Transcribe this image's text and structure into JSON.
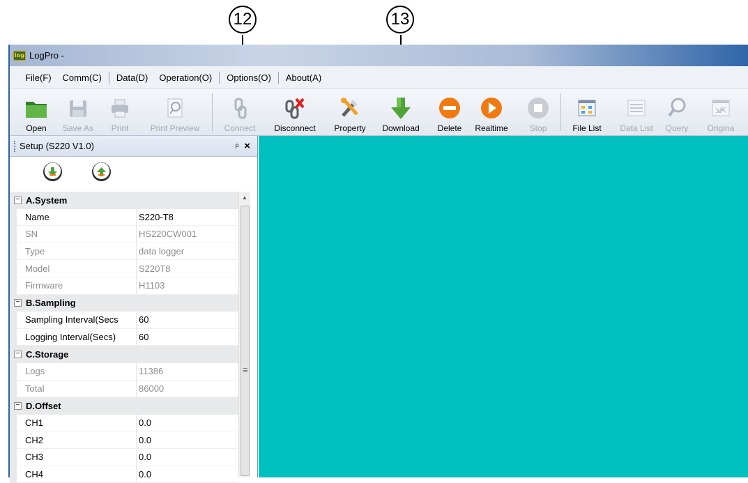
{
  "callouts": [
    "12",
    "13"
  ],
  "window": {
    "title": "LogPro -",
    "icon_text": "log"
  },
  "menu": [
    "File(F)",
    "Comm(C)",
    "Data(D)",
    "Operation(O)",
    "Options(O)",
    "About(A)"
  ],
  "toolbar": {
    "open": "Open",
    "save_as": "Save As",
    "print": "Print",
    "print_preview": "Print Preview",
    "connect": "Connect",
    "disconnect": "Disconnect",
    "property": "Property",
    "download": "Download",
    "delete": "Delete",
    "realtime": "Realtime",
    "stop": "Stop",
    "file_list": "File List",
    "data_list": "Data List",
    "query": "Query",
    "original": "Origina"
  },
  "panel": {
    "title": "Setup (S220 V1.0)",
    "pin": "ᵖ",
    "close": "×",
    "categories": [
      {
        "name": "A.System",
        "rows": [
          {
            "name": "Name",
            "value": "S220-T8"
          },
          {
            "name": "SN",
            "value": "HS220CW001"
          },
          {
            "name": "Type",
            "value": "data logger"
          },
          {
            "name": "Model",
            "value": "S220T8"
          },
          {
            "name": "Firmware",
            "value": "H1103"
          }
        ]
      },
      {
        "name": "B.Sampling",
        "rows": [
          {
            "name": "Sampling Interval(Secs",
            "value": "60"
          },
          {
            "name": "Logging Interval(Secs)",
            "value": "60"
          }
        ]
      },
      {
        "name": "C.Storage",
        "rows": [
          {
            "name": "Logs",
            "value": "11386"
          },
          {
            "name": "Total",
            "value": "86000"
          }
        ]
      },
      {
        "name": "D.Offset",
        "rows": [
          {
            "name": "CH1",
            "value": "0.0"
          },
          {
            "name": "CH2",
            "value": "0.0"
          },
          {
            "name": "CH3",
            "value": "0.0"
          },
          {
            "name": "CH4",
            "value": "0.0"
          }
        ]
      }
    ]
  },
  "colors": {
    "main_area": "#00c1bf",
    "accent_green": "#4fa437",
    "accent_orange": "#f07a12"
  }
}
